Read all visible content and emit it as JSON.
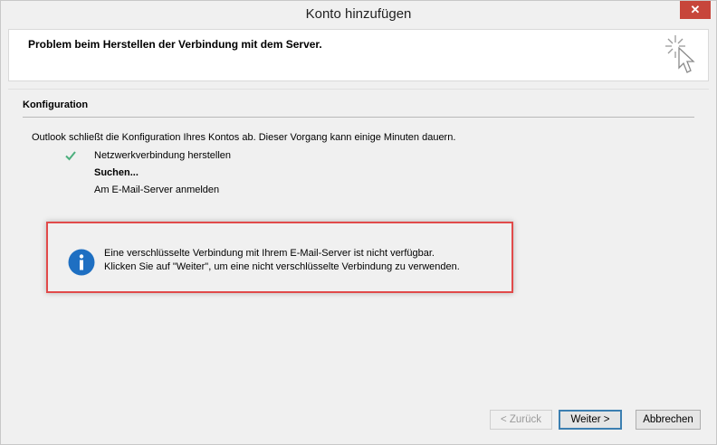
{
  "window": {
    "title": "Konto hinzufügen",
    "close_glyph": "✕"
  },
  "header": {
    "message": "Problem beim Herstellen der Verbindung mit dem Server.",
    "icon": "cursor-sparkle-icon"
  },
  "section": {
    "title": "Konfiguration",
    "description": "Outlook schließt die Konfiguration Ihres Kontos ab. Dieser Vorgang kann einige Minuten dauern."
  },
  "steps": [
    {
      "label": "Netzwerkverbindung herstellen",
      "status": "done",
      "icon": "checkmark-icon"
    },
    {
      "label": "Suchen...",
      "status": "active"
    },
    {
      "label": "Am E-Mail-Server anmelden",
      "status": "pending"
    }
  ],
  "info": {
    "icon": "info-icon",
    "line1": "Eine verschlüsselte Verbindung mit Ihrem E-Mail-Server ist nicht verfügbar.",
    "line2": "Klicken Sie auf \"Weiter\", um eine nicht verschlüsselte Verbindung zu verwenden.",
    "highlight_color": "#e14a4a"
  },
  "buttons": {
    "back": "< Zurück",
    "next": "Weiter >",
    "cancel": "Abbrechen"
  },
  "colors": {
    "close_button": "#c7463b",
    "check": "#4caf7d",
    "info_blue": "#1e6fc2"
  }
}
